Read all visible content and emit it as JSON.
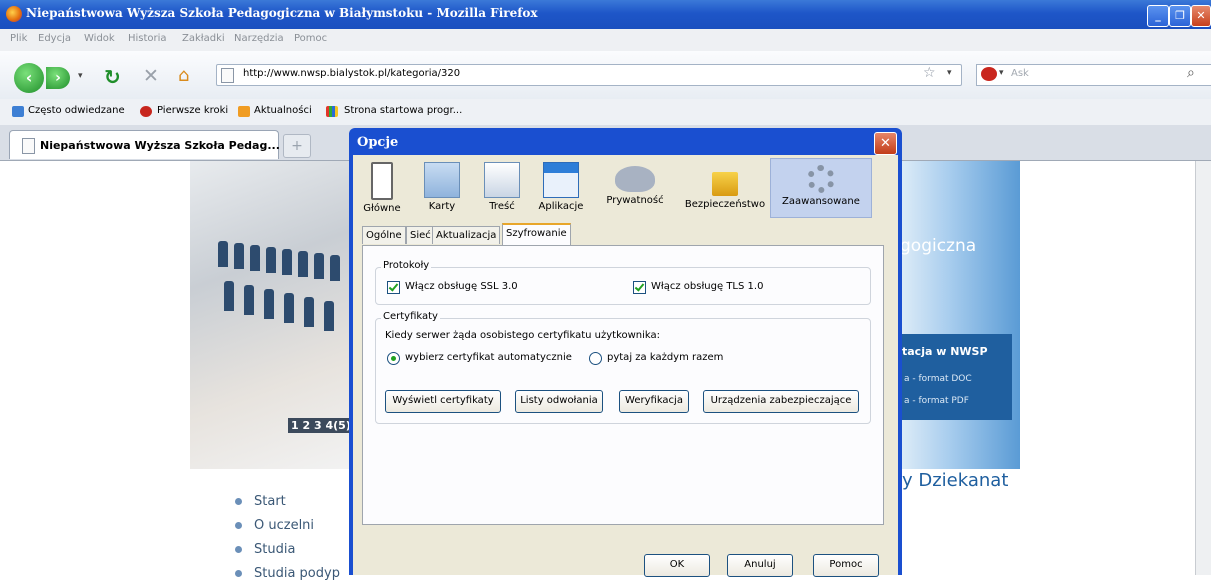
{
  "window": {
    "title": "Niepaństwowa Wyższa Szkoła Pedagogiczna w Białymstoku - Mozilla Firefox"
  },
  "menu": [
    "Plik",
    "Edycja",
    "Widok",
    "Historia",
    "Zakładki",
    "Narzędzia",
    "Pomoc"
  ],
  "nav": {
    "url": "http://www.nwsp.bialystok.pl/kategoria/320",
    "search_placeholder": "Ask"
  },
  "bookmarks": [
    "Często odwiedzane",
    "Pierwsze kroki",
    "Aktualności",
    "Strona startowa progr..."
  ],
  "tab": {
    "title": "Niepaństwowa Wyższa Szkoła Pedag...",
    "new_tab": "+"
  },
  "page": {
    "gallery_numbers": "1 2 3 4(5)",
    "subtitle_fragment": "gogiczna",
    "link_box": {
      "title": "tacja w NWSP",
      "links": [
        "a - format DOC",
        "a - format PDF"
      ]
    },
    "dziekanat": "y Dziekanat",
    "sidenav": [
      "Start",
      "O uczelni",
      "Studia",
      "Studia podyp"
    ]
  },
  "dialog": {
    "title": "Opcje",
    "close": "✕",
    "categories": [
      "Główne",
      "Karty",
      "Treść",
      "Aplikacje",
      "Prywatność",
      "Bezpieczeństwo",
      "Zaawansowane"
    ],
    "subtabs": [
      "Ogólne",
      "Sieć",
      "Aktualizacja",
      "Szyfrowanie"
    ],
    "protocols": {
      "label": "Protokoły",
      "ssl": "Włącz obsługę SSL 3.0",
      "tls": "Włącz obsługę TLS 1.0"
    },
    "certs": {
      "label": "Certyfikaty",
      "question": "Kiedy serwer żąda osobistego certyfikatu użytkownika:",
      "auto": "wybierz certyfikat automatycznie",
      "ask": "pytaj za każdym razem",
      "buttons": [
        "Wyświetl certyfikaty",
        "Listy odwołania",
        "Weryfikacja",
        "Urządzenia zabezpieczające"
      ]
    },
    "footer": {
      "ok": "OK",
      "cancel": "Anuluj",
      "help": "Pomoc"
    }
  }
}
